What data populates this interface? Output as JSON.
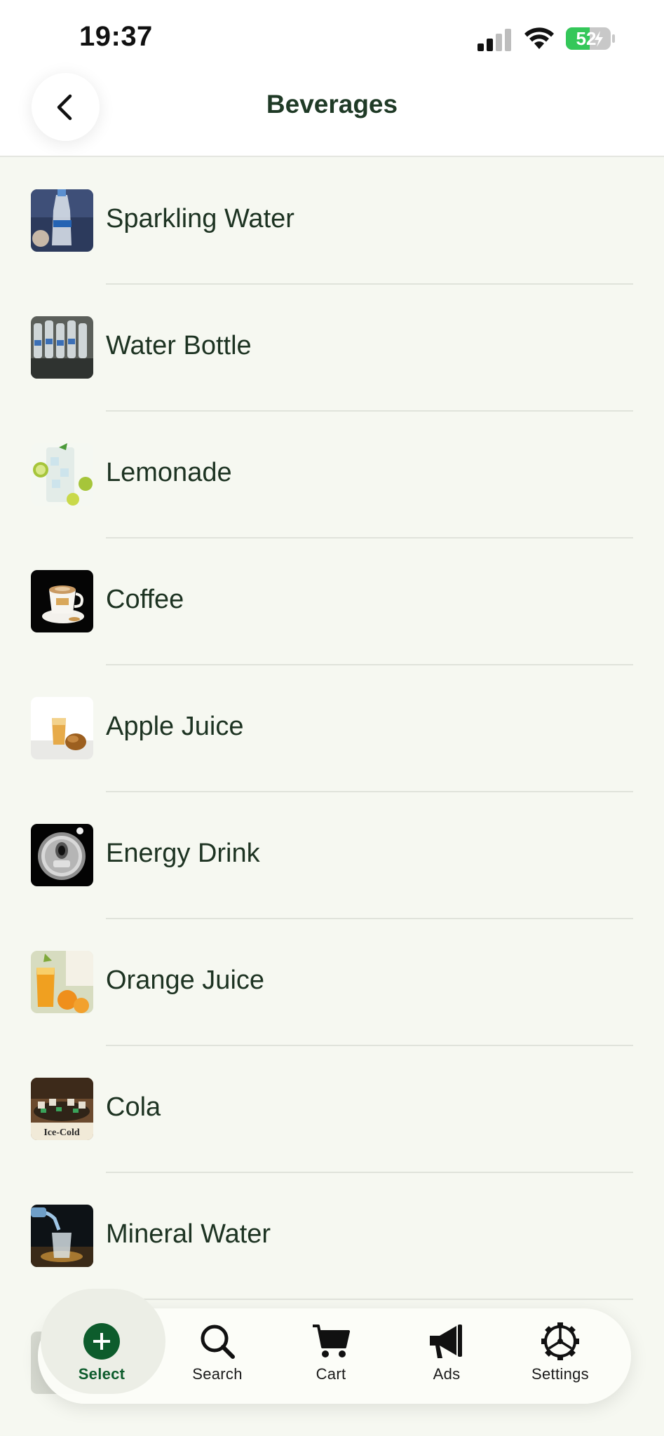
{
  "status_bar": {
    "time": "19:37",
    "battery": "52"
  },
  "header": {
    "title": "Beverages",
    "back_icon": "chevron-left-icon"
  },
  "items": [
    {
      "label": "Sparkling Water"
    },
    {
      "label": "Water Bottle"
    },
    {
      "label": "Lemonade"
    },
    {
      "label": "Coffee"
    },
    {
      "label": "Apple Juice"
    },
    {
      "label": "Energy Drink"
    },
    {
      "label": "Orange Juice"
    },
    {
      "label": "Cola"
    },
    {
      "label": "Mineral Water"
    }
  ],
  "tabs": [
    {
      "label": "Select",
      "icon": "plus-circle-icon",
      "active": true
    },
    {
      "label": "Search",
      "icon": "search-icon"
    },
    {
      "label": "Cart",
      "icon": "cart-icon"
    },
    {
      "label": "Ads",
      "icon": "megaphone-icon"
    },
    {
      "label": "Settings",
      "icon": "gear-icon"
    }
  ],
  "colors": {
    "accent": "#0d5c2c",
    "background": "#f6f8f1",
    "battery": "#34c759"
  }
}
